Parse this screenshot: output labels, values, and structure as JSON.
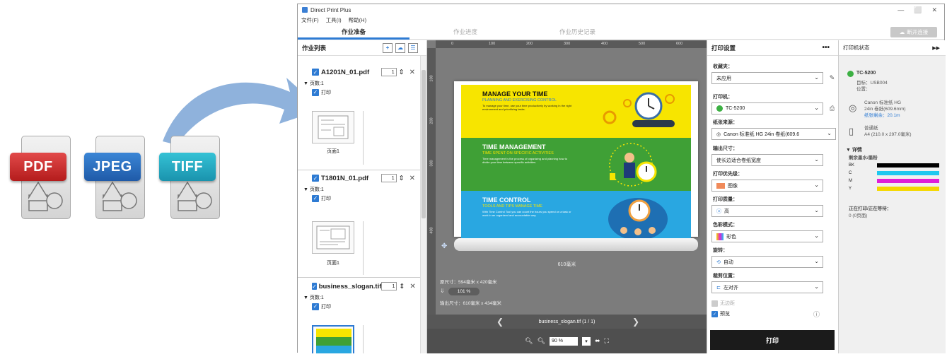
{
  "file_icons": {
    "pdf": "PDF",
    "jpeg": "JPEG",
    "tiff": "TIFF"
  },
  "window": {
    "title": "Direct Print Plus",
    "controls": [
      "—",
      "⬜",
      "✕"
    ]
  },
  "menu": [
    "文件(F)",
    "工具(I)",
    "帮助(H)"
  ],
  "tabs": [
    {
      "label": "作业准备"
    },
    {
      "label": "作业进度"
    },
    {
      "label": "作业历史记录"
    }
  ],
  "connect_button": "断开连接",
  "joblist": {
    "title": "作业列表",
    "jobs": [
      {
        "name": "A1201N_01.pdf",
        "copies": "1",
        "pages_label": "▼ 页数:1",
        "print_label": "打印",
        "page_label": "页面1"
      },
      {
        "name": "T1801N_01.pdf",
        "copies": "1",
        "pages_label": "▼ 页数:1",
        "print_label": "打印",
        "page_label": "页面1"
      },
      {
        "name": "business_slogan.tif",
        "copies": "1",
        "pages_label": "▼ 页数:1",
        "print_label": "打印",
        "page_label": ""
      }
    ]
  },
  "preview": {
    "ruler_top": [
      "0",
      "100",
      "200",
      "300",
      "400",
      "500",
      "600"
    ],
    "ruler_left": [
      "100",
      "200",
      "300",
      "400"
    ],
    "bands": [
      {
        "title": "MANAGE YOUR TIME",
        "sub": "PLANNING AND EXERCISING CONTROL",
        "desc": "To manage your time, use your time productively by working in the right environment and prioritizing tasks."
      },
      {
        "title": "TIME MANAGEMENT",
        "sub": "TIME SPENT ON SPECIFIC ACTIVITIES",
        "desc": "Time management is the process of organizing and planning how to divide your time between specific activities."
      },
      {
        "title": "TIME CONTROL",
        "sub": "TOOLS AND TIPS MANAGE TIME",
        "desc": "With Time Control Tool you can count the hours you spend on a task or work in an organized and accountable way"
      }
    ],
    "roll_width": "610毫米",
    "original_size": "原尺寸：594毫米 x 420毫米",
    "zoom_percent": "101 %",
    "output_size": "输出尺寸：610毫米 x 434毫米",
    "file_nav": "business_slogan.tif (1 / 1)",
    "zoom_value": "90 %"
  },
  "settings": {
    "title": "打印设置",
    "favorites_label": "收藏夹：",
    "favorites_value": "未应用",
    "printer_label": "打印机：",
    "printer_value": "TC-5200",
    "paper_source_label": "纸张来源：",
    "paper_source_value": "Canon 标准纸 HG 24in 卷纸(609.6",
    "output_size_label": "输出尺寸：",
    "output_size_value": "使长边适合卷纸宽度",
    "priority_label": "打印优先级：",
    "priority_value": "图像",
    "quality_label": "打印质量：",
    "quality_value": "高",
    "color_label": "色彩模式：",
    "color_value": "彩色",
    "rotate_label": "旋转：",
    "rotate_value": "自动",
    "align_label": "裁剪位置：",
    "align_value": "左对齐",
    "borderless_label": "无边距",
    "preview_label": "预览",
    "print_button": "打印"
  },
  "status": {
    "title": "打印机状态",
    "printer_name": "TC-5200",
    "target": "目标：USB004",
    "location": "位置：",
    "roll_paper": "Canon 标准纸 HG",
    "roll_size": "24in 卷纸(609.6mm)",
    "roll_remaining": "纸张剩余：20.1m",
    "sheet_paper": "普通纸",
    "sheet_size": "A4 (210.0 x 297.0毫米)",
    "details": "▼ 详情",
    "ink_label": "剩余墨水/墨粉",
    "inks": [
      {
        "name": "BK",
        "color": "#000000"
      },
      {
        "name": "C",
        "color": "#1ec8f0"
      },
      {
        "name": "M",
        "color": "#e01fd8"
      },
      {
        "name": "Y",
        "color": "#f5d800"
      }
    ],
    "jobs_waiting_label": "正在打印/正在等待：",
    "jobs_waiting_value": "0 (0页面)"
  }
}
